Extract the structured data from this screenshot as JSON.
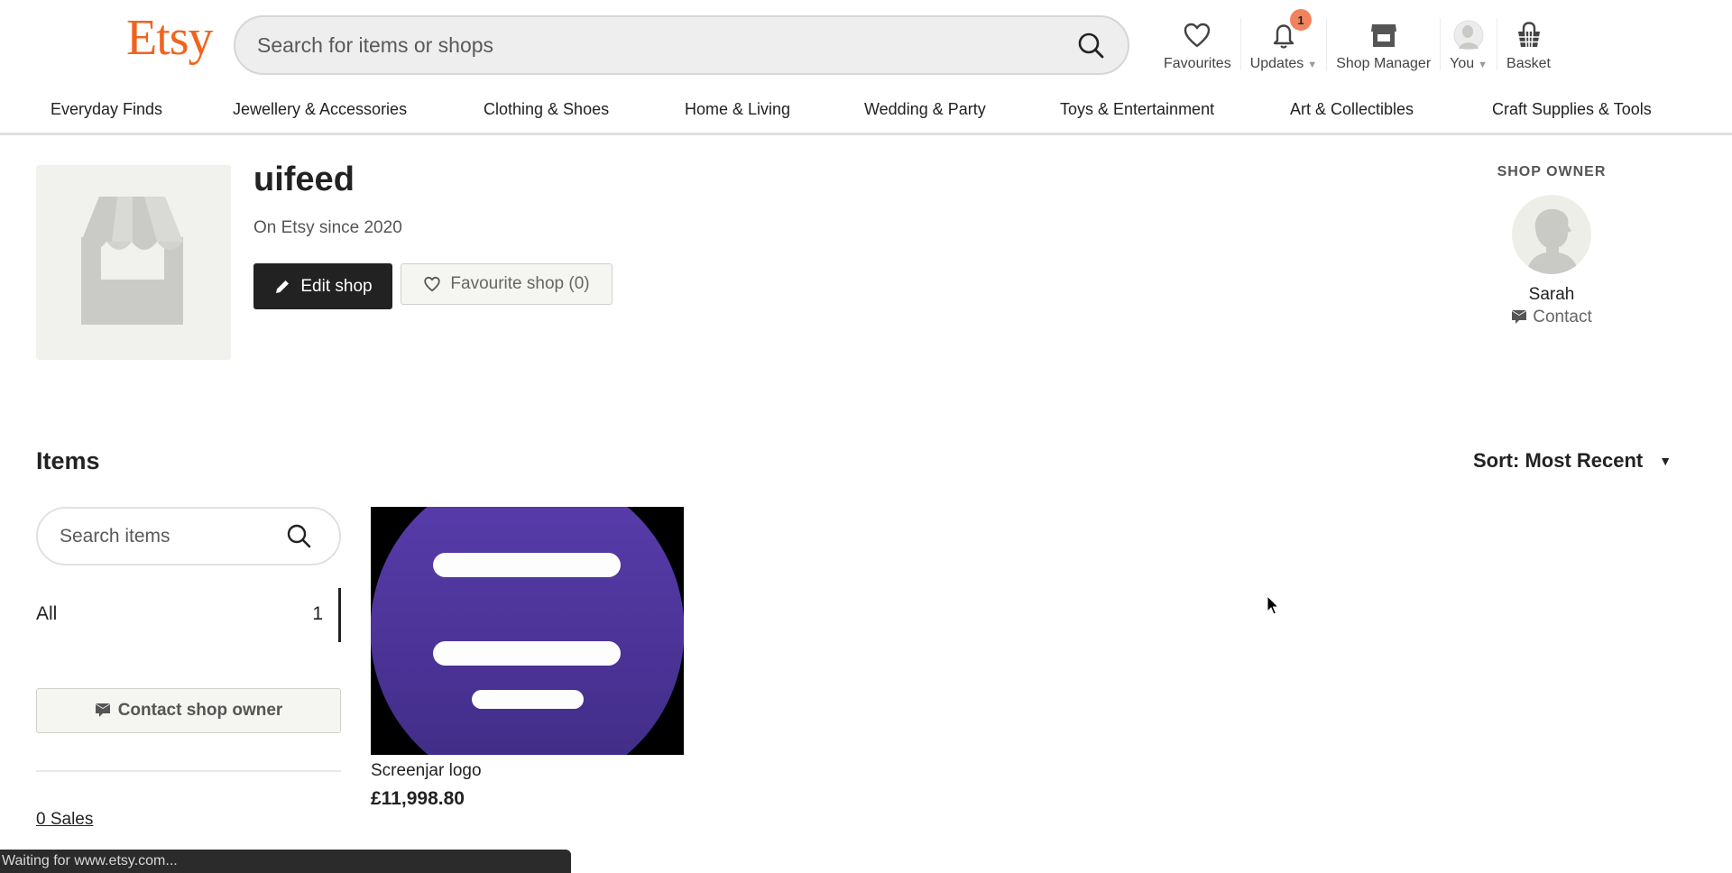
{
  "header": {
    "logo_text": "Etsy",
    "logo_color": "#F1641E",
    "search_placeholder": "Search for items or shops",
    "nav": {
      "favourites": "Favourites",
      "updates": "Updates",
      "updates_badge": "1",
      "shop_manager": "Shop Manager",
      "you": "You",
      "basket": "Basket"
    }
  },
  "categories": [
    "Everyday Finds",
    "Jewellery & Accessories",
    "Clothing & Shoes",
    "Home & Living",
    "Wedding & Party",
    "Toys & Entertainment",
    "Art & Collectibles",
    "Craft Supplies & Tools"
  ],
  "shop": {
    "name": "uifeed",
    "since": "On Etsy since 2020",
    "edit_label": "Edit shop",
    "favourite_label": "Favourite shop (0)"
  },
  "owner": {
    "heading": "SHOP OWNER",
    "name": "Sarah",
    "contact_label": "Contact"
  },
  "items": {
    "title": "Items",
    "sort_label": "Sort: Most Recent",
    "search_placeholder": "Search items",
    "filters": [
      {
        "label": "All",
        "count": "1"
      }
    ],
    "contact_owner_label": "Contact shop owner",
    "sales_label": "0 Sales",
    "listings": [
      {
        "title": "Screenjar logo",
        "price": "£11,998.80"
      }
    ]
  },
  "status_bar": {
    "text": "Waiting for www.etsy.com..."
  }
}
